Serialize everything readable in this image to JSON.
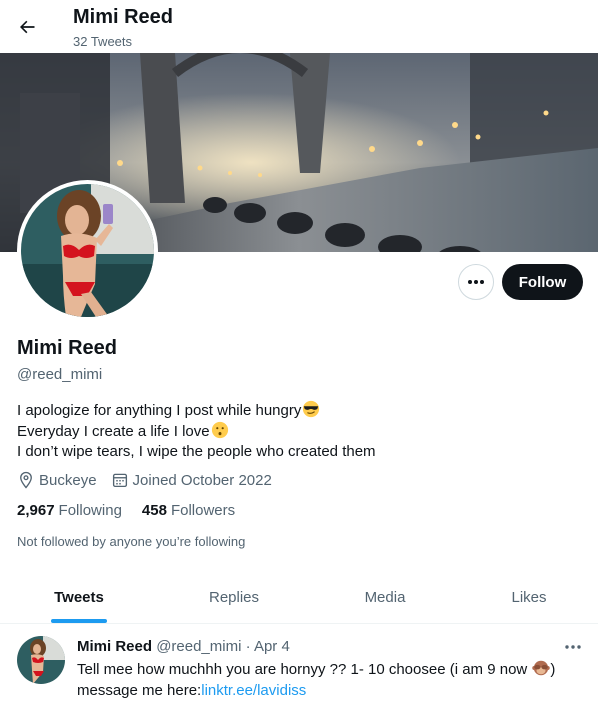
{
  "header": {
    "title": "Mimi Reed",
    "subtitle": "32 Tweets"
  },
  "profile": {
    "name": "Mimi Reed",
    "handle": "@reed_mimi",
    "bio_lines": [
      "I apologize for anything I post while hungry",
      "Everyday I create a life I love",
      "I don’t wipe tears, I wipe the people who created them"
    ],
    "bio_emojis": [
      "smiling-face-with-sunglasses",
      "kissing-face"
    ],
    "location": "Buckeye",
    "joined": "Joined October 2022",
    "following_count": "2,967",
    "following_label": "Following",
    "followers_count": "458",
    "followers_label": "Followers",
    "not_followed_text": "Not followed by anyone you’re following"
  },
  "actions": {
    "follow_label": "Follow"
  },
  "tabs": [
    {
      "label": "Tweets",
      "active": true
    },
    {
      "label": "Replies",
      "active": false
    },
    {
      "label": "Media",
      "active": false
    },
    {
      "label": "Likes",
      "active": false
    }
  ],
  "tweet": {
    "author": "Mimi Reed",
    "handle": "@reed_mimi",
    "separator": "·",
    "date": "Apr 4",
    "text_part1": "Tell mee how muchhh you are hornyy ?? 1- 10 choosee (i am 9 now ",
    "text_part2": ")",
    "text_part3": "message me here:",
    "link": "linktr.ee/lavidiss",
    "emoji": "see-no-evil-monkey"
  },
  "colors": {
    "accent": "#1d9bf0",
    "text": "#0f1419",
    "muted": "#536471",
    "follow_bg": "#0f1419"
  }
}
